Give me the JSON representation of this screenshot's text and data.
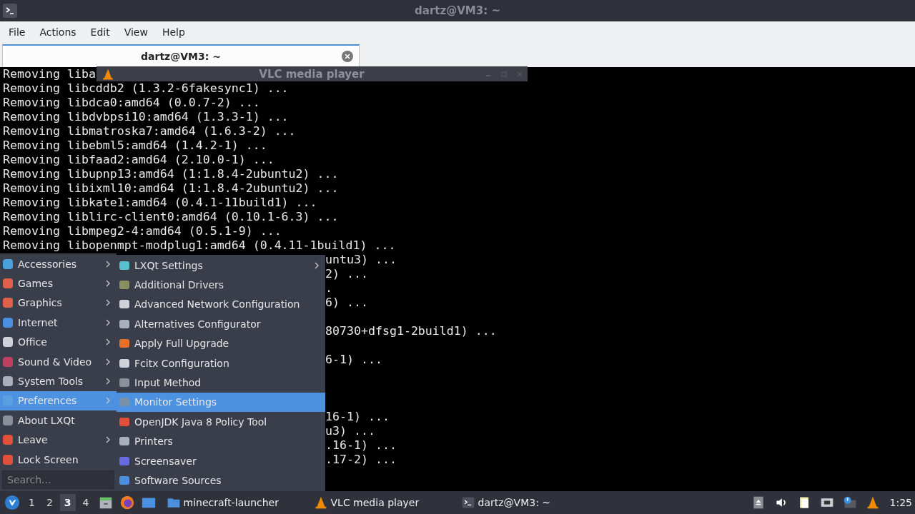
{
  "window": {
    "title": "dartz@VM3: ~"
  },
  "menubar": [
    "File",
    "Actions",
    "Edit",
    "View",
    "Help"
  ],
  "tabs": [
    {
      "label": "dartz@VM3: ~",
      "selected": true
    }
  ],
  "terminal": {
    "lines": [
      {
        "kind": "full",
        "text": "Removing liba"
      },
      {
        "kind": "full",
        "text": "Removing libcddb2 (1.3.2-6fakesync1) ..."
      },
      {
        "kind": "full",
        "text": "Removing libdca0:amd64 (0.0.7-2) ..."
      },
      {
        "kind": "full",
        "text": "Removing libdvbpsi10:amd64 (1.3.3-1) ..."
      },
      {
        "kind": "full",
        "text": "Removing libmatroska7:amd64 (1.6.3-2) ..."
      },
      {
        "kind": "full",
        "text": "Removing libebml5:amd64 (1.4.2-1) ..."
      },
      {
        "kind": "full",
        "text": "Removing libfaad2:amd64 (2.10.0-1) ..."
      },
      {
        "kind": "full",
        "text": "Removing libupnp13:amd64 (1:1.8.4-2ubuntu2) ..."
      },
      {
        "kind": "full",
        "text": "Removing libixml10:amd64 (1:1.8.4-2ubuntu2) ..."
      },
      {
        "kind": "full",
        "text": "Removing libkate1:amd64 (0.4.1-11build1) ..."
      },
      {
        "kind": "full",
        "text": "Removing liblirc-client0:amd64 (0.10.1-6.3) ..."
      },
      {
        "kind": "full",
        "text": "Removing libmpeg2-4:amd64 (0.5.1-9) ..."
      },
      {
        "kind": "full",
        "text": "Removing libopenmpt-modplug1:amd64 (0.4.11-1build1) ..."
      },
      {
        "kind": "tail",
        "text": "untu3) ..."
      },
      {
        "kind": "tail",
        "text": "2) ..."
      },
      {
        "kind": "tail",
        "text": "."
      },
      {
        "kind": "tail",
        "text": "6) ..."
      },
      {
        "kind": "blank"
      },
      {
        "kind": "tail",
        "text": "80730+dfsg1-2build1) ..."
      },
      {
        "kind": "blank"
      },
      {
        "kind": "tail",
        "text": "6-1) ..."
      },
      {
        "kind": "blank"
      },
      {
        "kind": "blank"
      },
      {
        "kind": "blank"
      },
      {
        "kind": "tail",
        "text": "16-1) ..."
      },
      {
        "kind": "tail",
        "text": "u3) ..."
      },
      {
        "kind": "tail",
        "text": ".16-1) ..."
      },
      {
        "kind": "tail",
        "text": ".17-2) ..."
      }
    ]
  },
  "vlc_window": {
    "title": "VLC media player"
  },
  "app_menu": {
    "items": [
      {
        "label": "Accessories",
        "submenu": true,
        "selected": false
      },
      {
        "label": "Games",
        "submenu": true,
        "selected": false
      },
      {
        "label": "Graphics",
        "submenu": true,
        "selected": false
      },
      {
        "label": "Internet",
        "submenu": true,
        "selected": false
      },
      {
        "label": "Office",
        "submenu": true,
        "selected": false
      },
      {
        "label": "Sound & Video",
        "submenu": true,
        "selected": false
      },
      {
        "label": "System Tools",
        "submenu": true,
        "selected": false
      },
      {
        "label": "Preferences",
        "submenu": true,
        "selected": true
      },
      {
        "label": "About LXQt",
        "submenu": false,
        "selected": false
      },
      {
        "label": "Leave",
        "submenu": true,
        "selected": false
      },
      {
        "label": "Lock Screen",
        "submenu": false,
        "selected": false
      }
    ],
    "search": {
      "placeholder": "Search..."
    }
  },
  "submenu": {
    "items": [
      {
        "label": "LXQt Settings",
        "submenu": true,
        "selected": false
      },
      {
        "label": "Additional Drivers",
        "submenu": false,
        "selected": false
      },
      {
        "label": "Advanced Network Configuration",
        "submenu": false,
        "selected": false
      },
      {
        "label": "Alternatives Configurator",
        "submenu": false,
        "selected": false
      },
      {
        "label": "Apply Full Upgrade",
        "submenu": false,
        "selected": false
      },
      {
        "label": "Fcitx Configuration",
        "submenu": false,
        "selected": false
      },
      {
        "label": "Input Method",
        "submenu": false,
        "selected": false
      },
      {
        "label": "Monitor Settings",
        "submenu": false,
        "selected": true
      },
      {
        "label": "OpenJDK Java 8 Policy Tool",
        "submenu": false,
        "selected": false
      },
      {
        "label": "Printers",
        "submenu": false,
        "selected": false
      },
      {
        "label": "Screensaver",
        "submenu": false,
        "selected": false
      },
      {
        "label": "Software Sources",
        "submenu": false,
        "selected": false
      }
    ]
  },
  "taskbar": {
    "desktops": [
      {
        "label": "1",
        "selected": false
      },
      {
        "label": "2",
        "selected": false
      },
      {
        "label": "3",
        "selected": true
      },
      {
        "label": "4",
        "selected": false
      }
    ],
    "tasks": [
      {
        "label": "minecraft-launcher",
        "kind": "folder"
      },
      {
        "label": "VLC media player",
        "kind": "vlc"
      },
      {
        "label": "dartz@VM3: ~",
        "kind": "terminal"
      }
    ],
    "clock": "1:25"
  }
}
